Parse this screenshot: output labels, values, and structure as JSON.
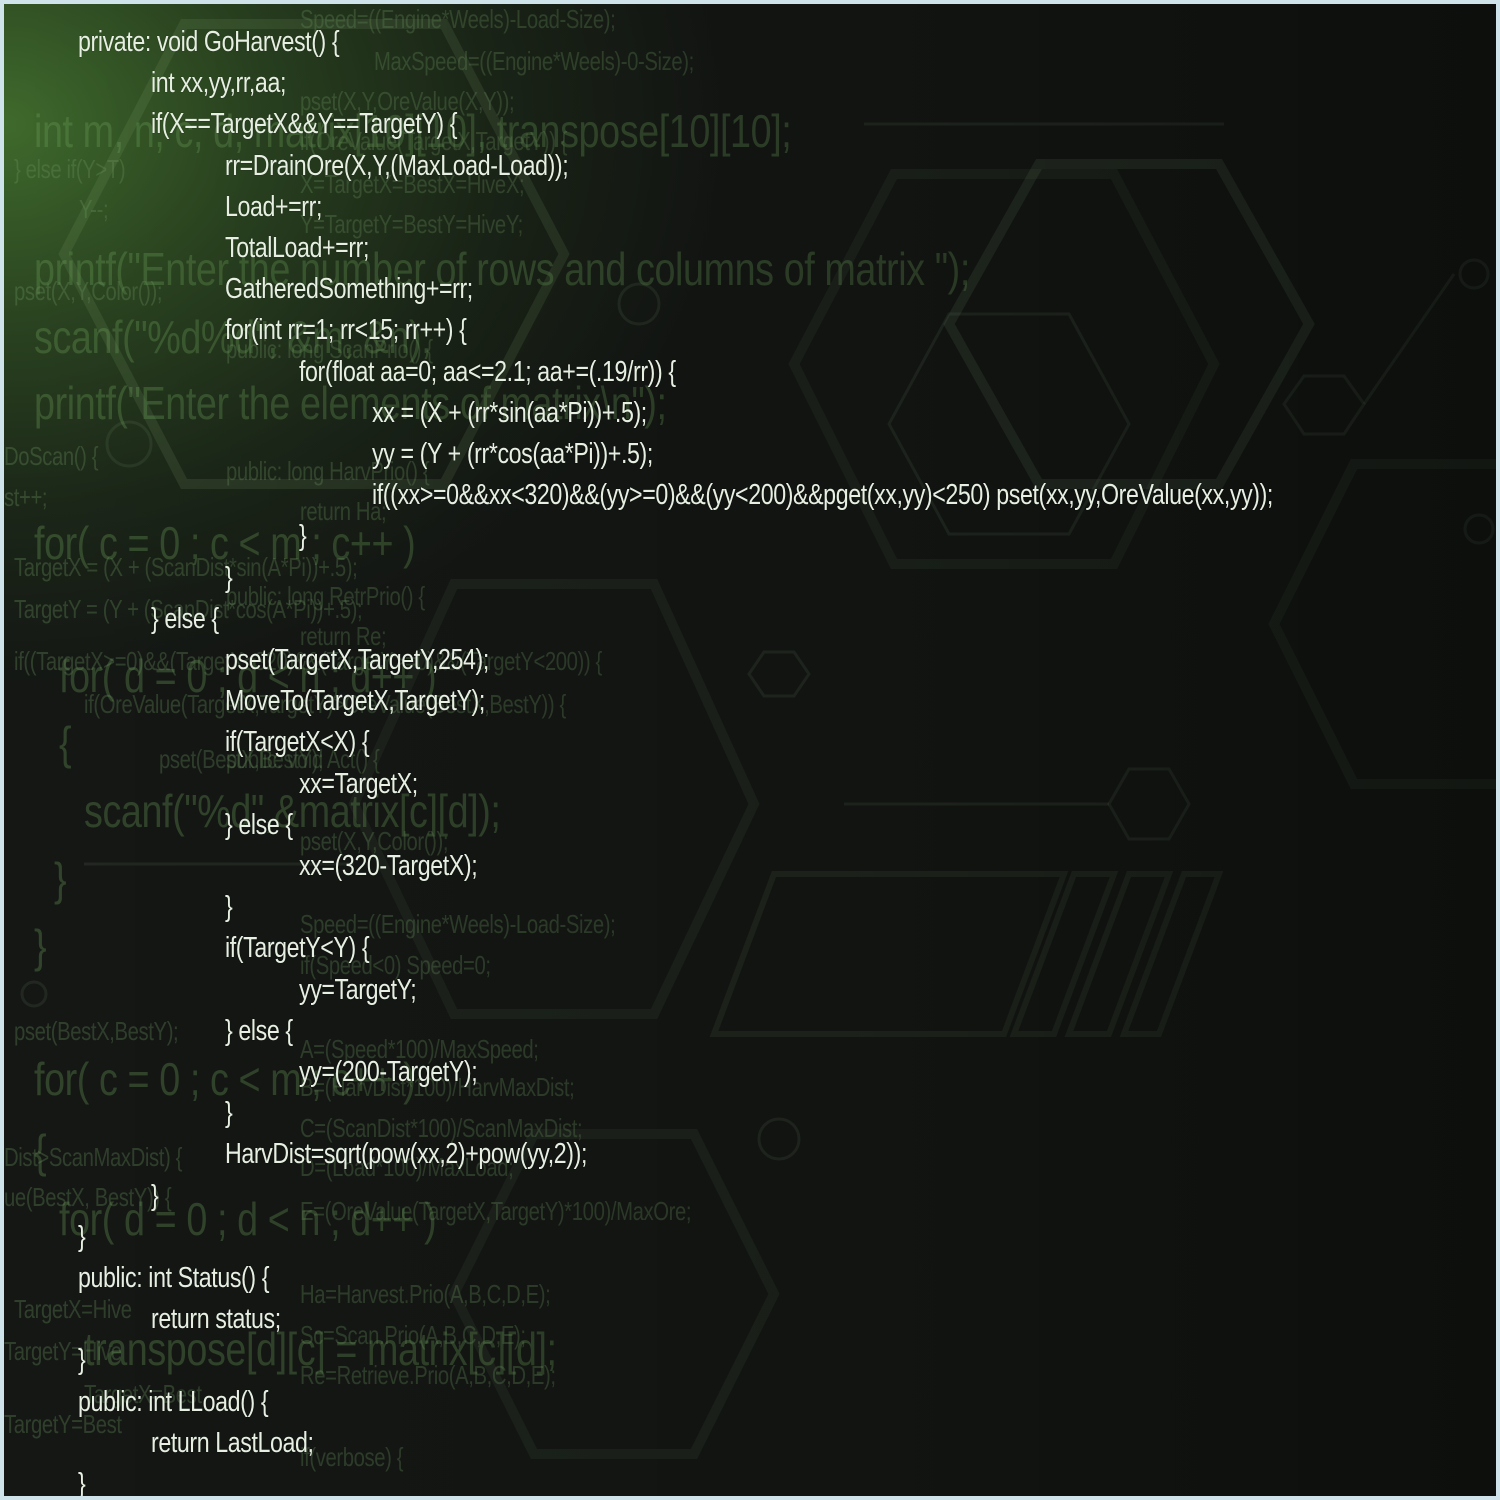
{
  "code_lines": [
    "private: void GoHarvest() {",
    "int xx,yy,rr,aa;",
    "if(X==TargetX&&Y==TargetY) {",
    "rr=DrainOre(X,Y,(MaxLoad-Load));",
    "Load+=rr;",
    "TotalLoad+=rr;",
    "GatheredSomething+=rr;",
    "for(int rr=1; rr<15; rr++) {",
    "for(float aa=0; aa<=2.1; aa+=(.19/rr)) {",
    "xx = (X + (rr*sin(aa*Pi))+.5);",
    "yy = (Y + (rr*cos(aa*Pi))+.5);",
    "if((xx>=0&&xx<320)&&(yy>=0)&&(yy<200)&&pget(xx,yy)<250) pset(xx,yy,OreValue(xx,yy));",
    "}",
    "}",
    "} else {",
    "pset(TargetX,TargetY,254);",
    "MoveTo(TargetX,TargetY);",
    "if(TargetX<X) {",
    "xx=TargetX;",
    "} else {",
    "xx=(320-TargetX);",
    "}",
    "if(TargetY<Y) {",
    "yy=TargetY;",
    "} else {",
    "yy=(200-TargetY);",
    "}",
    "HarvDist=sqrt(pow(xx,2)+pow(yy,2));",
    "}",
    "}",
    "public: int Status() {",
    "return status;",
    "}",
    "public: int LLoad() {",
    "return LastLoad;",
    "}"
  ],
  "background_big": [
    "int m, n, c, d, matrix[10][10], transpose[10][10];",
    "printf(\"Enter the number of rows and columns of matrix \");",
    "scanf(\"%d%d\", &m, &n);",
    "printf(\"Enter the elements of matrix\\n\");",
    "for( c = 0 ; c < m ; c++ )",
    "for( d = 0 ; d < n ; d++ )",
    "{",
    "scanf(\"%d\",&matrix[c][d]);",
    "}",
    "}",
    "for( c = 0 ; c < m ; c++ )",
    "{",
    "for( d = 0 ; d < n ; d++ )",
    "transpose[d][c] = matrix[c][d];"
  ],
  "background_small": [
    "Speed=((Engine*Weels)-Load-Size);",
    "MaxSpeed=((Engine*Weels)-0-Size);",
    "pset(X,Y,OreValue(X,Y));",
    "if(OreValue(TargetX,TargetY)) {",
    "X=TargetX=BestX=HiveX;",
    "Y=TargetY=BestY=HiveY;",
    "public: long ScanPrio() {",
    "public: long HarvPrio() {",
    "return Ha;",
    "public: long RetrPrio() {",
    "return Re;",
    "public: void Act() {",
    "pset(BestX,BestY);",
    "pset(X,Y,Color());",
    "Speed=((Engine*Weels)-Load-Size);",
    "if(Speed<0) Speed=0;",
    "A=(Speed*100)/MaxSpeed;",
    "B=(HarvDist*100)/HarvMaxDist;",
    "C=(ScanDist*100)/ScanMaxDist;",
    "D=(Load*100)/MaxLoad;",
    "E=(OreValue(TargetX,TargetY)*100)/MaxOre;",
    "Ha=Harvest.Prio(A,B,C,D,E);",
    "Sc=Scan.Prio(A,B,C,D,E);",
    "Re=Retrieve.Prio(A,B,C,D,E);",
    "if(verbose) {",
    "} else if(Y>T)",
    "Y--;",
    "pset(X,Y,Color());",
    "DoScan() {",
    "st++;",
    "TargetX = (X + (ScanDist*sin(A*Pi))+.5);",
    "TargetY = (Y + (ScanDist*cos(A*Pi))+.5);",
    "if((TargetX>=0)&&(TargetX<320)&&(TargetY>=0)&&(TargetY<200)) {",
    "if(OreValue(TargetX,TargetY)>OreValue(BestX,BestY)) {",
    "pset(BestX,BestY);",
    "Dist>ScanMaxDist) {",
    "ue(BestX, BestY)) {",
    "TargetX=Hive",
    "TargetY=Hive",
    "TargetX=Best",
    "TargetY=Best"
  ]
}
